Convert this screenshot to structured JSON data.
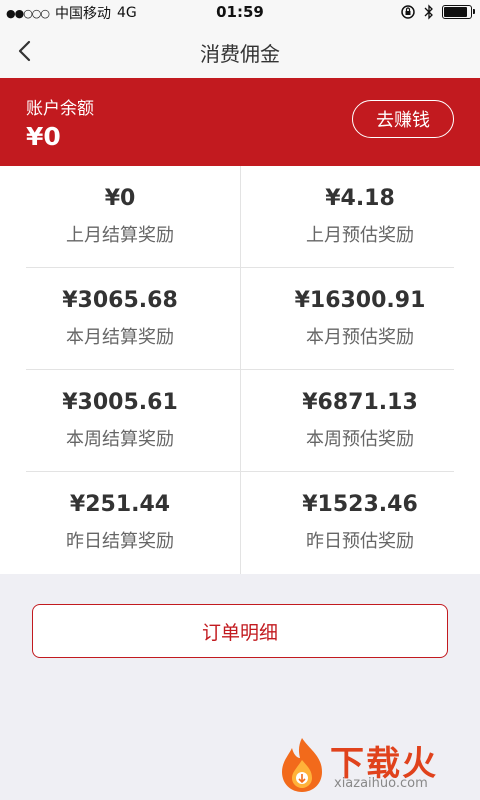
{
  "status_bar": {
    "signal": "●●○○○",
    "carrier": "中国移动",
    "network": "4G",
    "time": "01:59",
    "battery_level": 0.9
  },
  "nav": {
    "title": "消费佣金",
    "back_icon": "chevron-left-icon"
  },
  "account": {
    "label": "账户余额",
    "amount": "¥0",
    "earn_button": "去赚钱"
  },
  "stats": [
    {
      "value": "¥0",
      "label": "上月结算奖励"
    },
    {
      "value": "¥4.18",
      "label": "上月预估奖励"
    },
    {
      "value": "¥3065.68",
      "label": "本月结算奖励"
    },
    {
      "value": "¥16300.91",
      "label": "本月预估奖励"
    },
    {
      "value": "¥3005.61",
      "label": "本周结算奖励"
    },
    {
      "value": "¥6871.13",
      "label": "本周预估奖励"
    },
    {
      "value": "¥251.44",
      "label": "昨日结算奖励"
    },
    {
      "value": "¥1523.46",
      "label": "昨日预估奖励"
    }
  ],
  "order_button": "订单明细",
  "watermark": {
    "title": "下载火",
    "url": "xiazaihuo.com"
  },
  "colors": {
    "brand_red": "#c21a1f",
    "background": "#efeff4"
  }
}
